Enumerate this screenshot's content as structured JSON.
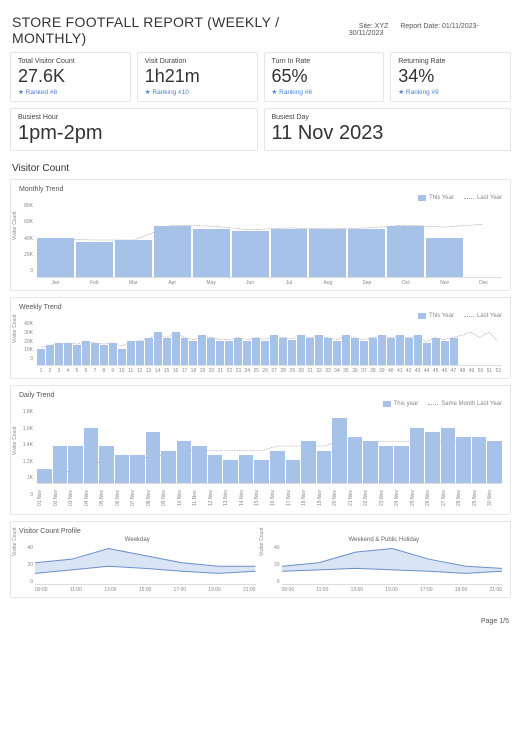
{
  "header": {
    "title": "STORE FOOTFALL REPORT (WEEKLY / MONTHLY)",
    "site_label": "Site: XYZ",
    "date_label": "Report Date: 01/11/2023-30/11/2023"
  },
  "kpi": [
    {
      "label": "Total Visitor Count",
      "value": "27.6K",
      "rank": "★ Ranked #8"
    },
    {
      "label": "Visit Duration",
      "value": "1h21m",
      "rank": "★ Ranking #10"
    },
    {
      "label": "Turn In Rate",
      "value": "65%",
      "rank": "★ Ranking #6"
    },
    {
      "label": "Returning Rate",
      "value": "34%",
      "rank": "★ Ranking #9"
    }
  ],
  "busy": [
    {
      "label": "Busiest Hour",
      "value": "1pm-2pm"
    },
    {
      "label": "Busiest Day",
      "value": "11 Nov 2023"
    }
  ],
  "section_title": "Visitor Count",
  "panels": {
    "monthly": {
      "title": "Monthly Trend",
      "legend_this": "This Year",
      "legend_last": "Last Year"
    },
    "weekly": {
      "title": "Weekly Trend",
      "legend_this": "This Year",
      "legend_last": "Last Year"
    },
    "daily": {
      "title": "Daily Trend",
      "legend_this": "This year",
      "legend_last": "Same Month Last Year"
    },
    "profile": {
      "title": "Visitor Count Profile",
      "weekday": "Weekday",
      "weekend": "Weekend & Public Holiday"
    }
  },
  "ylabel": "Visitor Count",
  "footer": "Page 1/5",
  "chart_data": [
    {
      "id": "monthly",
      "type": "bar",
      "categories": [
        "Jan",
        "Feb",
        "Mar",
        "Apr",
        "May",
        "Jun",
        "Jul",
        "Aug",
        "Sep",
        "Oct",
        "Nov",
        "Dec"
      ],
      "series": [
        {
          "name": "This Year",
          "values": [
            42000,
            38000,
            40000,
            55000,
            52000,
            50000,
            52000,
            52000,
            52000,
            55000,
            42000,
            null
          ]
        },
        {
          "name": "Last Year",
          "values": [
            41000,
            40000,
            40000,
            56000,
            55000,
            51000,
            53000,
            52000,
            53000,
            56000,
            54000,
            57000
          ]
        }
      ],
      "yticks": [
        0,
        20000,
        40000,
        60000,
        80000
      ],
      "ylim": [
        0,
        80000
      ],
      "ylabel": "Visitor Count"
    },
    {
      "id": "weekly",
      "type": "bar",
      "categories": [
        "1",
        "2",
        "3",
        "4",
        "5",
        "6",
        "7",
        "8",
        "9",
        "10",
        "11",
        "12",
        "13",
        "14",
        "15",
        "16",
        "17",
        "18",
        "19",
        "20",
        "21",
        "22",
        "23",
        "24",
        "25",
        "26",
        "27",
        "28",
        "29",
        "30",
        "31",
        "32",
        "33",
        "34",
        "35",
        "36",
        "37",
        "38",
        "39",
        "40",
        "41",
        "42",
        "43",
        "44",
        "45",
        "46",
        "47",
        "48",
        "49",
        "50",
        "51",
        "52"
      ],
      "series": [
        {
          "name": "This Year",
          "values": [
            15000,
            18000,
            20000,
            20000,
            18000,
            22000,
            20000,
            18000,
            20000,
            15000,
            22000,
            22000,
            25000,
            30000,
            25000,
            30000,
            25000,
            22000,
            27000,
            25000,
            22000,
            22000,
            25000,
            22000,
            25000,
            22000,
            27000,
            25000,
            23000,
            27000,
            25000,
            27000,
            25000,
            22000,
            27000,
            25000,
            22000,
            25000,
            27000,
            25000,
            27000,
            25000,
            27000,
            20000,
            25000,
            22000,
            25000,
            null,
            null,
            null,
            null,
            null
          ]
        },
        {
          "name": "Last Year",
          "values": [
            16000,
            18000,
            19000,
            20000,
            19000,
            21000,
            20000,
            19000,
            20000,
            17000,
            21000,
            22000,
            24000,
            28000,
            25000,
            29000,
            25000,
            23000,
            26000,
            25000,
            23000,
            23000,
            25000,
            23000,
            25000,
            23000,
            26000,
            25000,
            24000,
            26000,
            25000,
            26000,
            25000,
            23000,
            26000,
            25000,
            23000,
            25000,
            26000,
            25000,
            26000,
            25000,
            26000,
            21000,
            25000,
            23000,
            25000,
            27000,
            30000,
            25000,
            30000,
            22000
          ]
        }
      ],
      "yticks": [
        0,
        10000,
        20000,
        30000,
        40000
      ],
      "ylim": [
        0,
        40000
      ],
      "ylabel": "Visitor Count"
    },
    {
      "id": "daily",
      "type": "bar",
      "categories": [
        "01 Nov",
        "02 Nov",
        "03 Nov",
        "04 Nov",
        "05 Nov",
        "06 Nov",
        "07 Nov",
        "08 Nov",
        "09 Nov",
        "10 Nov",
        "11 Nov",
        "12 Nov",
        "13 Nov",
        "14 Nov",
        "15 Nov",
        "16 Nov",
        "17 Nov",
        "18 Nov",
        "19 Nov",
        "20 Nov",
        "21 Nov",
        "22 Nov",
        "23 Nov",
        "24 Nov",
        "25 Nov",
        "26 Nov",
        "27 Nov",
        "28 Nov",
        "29 Nov",
        "30 Nov"
      ],
      "series": [
        {
          "name": "This year",
          "values": [
            1150,
            1400,
            1400,
            1600,
            1400,
            1300,
            1300,
            1550,
            1350,
            1450,
            1400,
            1300,
            1250,
            1300,
            1250,
            1350,
            1250,
            1450,
            1350,
            1700,
            1500,
            1450,
            1400,
            1400,
            1600,
            1550,
            1600,
            1500,
            1500,
            1450
          ]
        },
        {
          "name": "Same Month Last Year",
          "values": [
            1000,
            1100,
            1150,
            1200,
            1250,
            1250,
            1250,
            1300,
            1300,
            1350,
            1350,
            1350,
            1350,
            1350,
            1350,
            1400,
            1400,
            1400,
            1400,
            1450,
            1450,
            1450,
            1450,
            1450,
            1450,
            1450,
            1450,
            1450,
            1400,
            1400
          ]
        }
      ],
      "yticks": [
        0,
        1000,
        1200,
        1400,
        1600,
        1800
      ],
      "ylim": [
        1000,
        1800
      ],
      "ylabel": "Visitor Count"
    },
    {
      "id": "profile_weekday",
      "type": "area",
      "x": [
        "09:00",
        "11:00",
        "13:00",
        "15:00",
        "17:00",
        "19:00",
        "21:00"
      ],
      "series": [
        {
          "name": "upper",
          "values": [
            30,
            35,
            50,
            40,
            30,
            25,
            25
          ]
        },
        {
          "name": "lower",
          "values": [
            15,
            20,
            25,
            22,
            18,
            15,
            18
          ]
        }
      ],
      "yticks": [
        0,
        20,
        40
      ],
      "ylim": [
        0,
        55
      ],
      "ylabel": "Visitor Count"
    },
    {
      "id": "profile_weekend",
      "type": "area",
      "x": [
        "09:00",
        "11:00",
        "13:00",
        "15:00",
        "17:00",
        "19:00",
        "21:00"
      ],
      "series": [
        {
          "name": "upper",
          "values": [
            25,
            30,
            45,
            50,
            35,
            25,
            22
          ]
        },
        {
          "name": "lower",
          "values": [
            18,
            20,
            22,
            20,
            18,
            15,
            18
          ]
        }
      ],
      "yticks": [
        0,
        20,
        40
      ],
      "ylim": [
        0,
        55
      ],
      "ylabel": "Visitor Count"
    }
  ]
}
